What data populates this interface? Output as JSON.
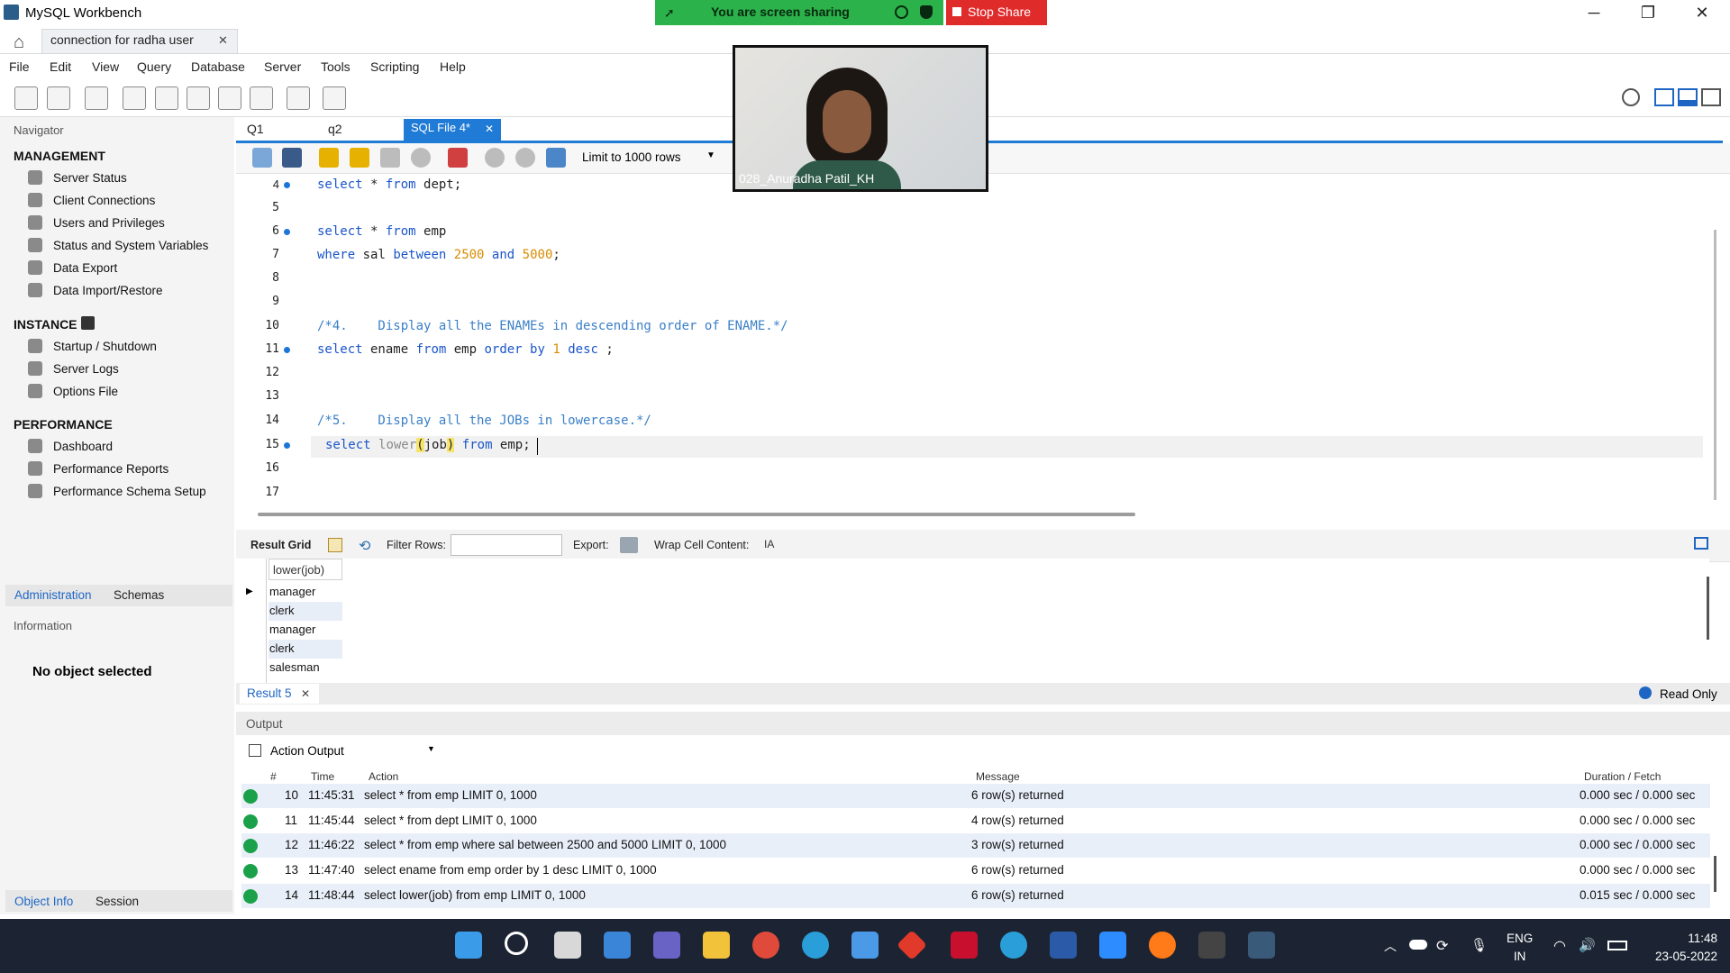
{
  "app": {
    "title": "MySQL Workbench",
    "connection_tab": "connection for radha  user"
  },
  "share": {
    "banner": "You are screen sharing",
    "stop": "Stop Share",
    "participant": "028_Anuradha Patil_KH"
  },
  "menu": [
    "File",
    "Edit",
    "View",
    "Query",
    "Database",
    "Server",
    "Tools",
    "Scripting",
    "Help"
  ],
  "navigator": {
    "header": "Navigator",
    "management": "MANAGEMENT",
    "management_items": [
      "Server Status",
      "Client Connections",
      "Users and Privileges",
      "Status and System Variables",
      "Data Export",
      "Data Import/Restore"
    ],
    "instance": "INSTANCE",
    "instance_items": [
      "Startup / Shutdown",
      "Server Logs",
      "Options File"
    ],
    "performance": "PERFORMANCE",
    "performance_items": [
      "Dashboard",
      "Performance Reports",
      "Performance Schema Setup"
    ],
    "tab_admin": "Administration",
    "tab_schemas": "Schemas",
    "info_header": "Information",
    "no_object": "No object selected",
    "tab_objinfo": "Object Info",
    "tab_session": "Session"
  },
  "editor_tabs": [
    "Q1",
    "q2",
    "SQL File 4*"
  ],
  "limit": "Limit to 1000 rows",
  "code_lines": {
    "l4": "4",
    "l5": "5",
    "l6": "6",
    "l7": "7",
    "l8": "8",
    "l9": "9",
    "l10": "10",
    "l11": "11",
    "l12": "12",
    "l13": "13",
    "l14": "14",
    "l15": "15",
    "l16": "16",
    "l17": "17"
  },
  "code": {
    "c4a": "select",
    "c4b": " * ",
    "c4c": "from",
    "c4d": " dept;",
    "c6a": "select",
    "c6b": " * ",
    "c6c": "from",
    "c6d": " emp",
    "c7a": "where",
    "c7b": " sal ",
    "c7c": "between",
    "c7d": " ",
    "c7e": "2500",
    "c7f": " ",
    "c7g": "and",
    "c7h": " ",
    "c7i": "5000",
    "c7j": ";",
    "c10": "/*4.    Display all the ENAMEs in descending order of ENAME.*/",
    "c11a": "select",
    "c11b": " ename ",
    "c11c": "from",
    "c11d": " emp ",
    "c11e": "order by",
    "c11f": " ",
    "c11g": "1",
    "c11h": " ",
    "c11i": "desc",
    "c11j": " ;",
    "c14": "/*5.    Display all the JOBs in lowercase.*/",
    "c15a": "select",
    "c15b": " ",
    "c15c": "lower",
    "c15d": "(",
    "c15e": "job",
    "c15f": ")",
    "c15g": " ",
    "c15h": "from",
    "c15i": " emp;"
  },
  "result_bar": {
    "result_grid": "Result Grid",
    "filter_rows": "Filter Rows:",
    "export": "Export:",
    "wrap": "Wrap Cell Content:",
    "result_tab": "Result 5",
    "read_only": "Read Only"
  },
  "grid": {
    "header": "lower(job)",
    "rows": [
      "manager",
      "clerk",
      "manager",
      "clerk",
      "salesman"
    ]
  },
  "output": {
    "header": "Output",
    "selector": "Action Output",
    "columns": [
      "#",
      "Time",
      "Action",
      "Message",
      "Duration / Fetch"
    ],
    "rows": [
      {
        "n": "10",
        "time": "11:45:31",
        "action": "select * from emp LIMIT 0, 1000",
        "msg": "6 row(s) returned",
        "dur": "0.000 sec / 0.000 sec"
      },
      {
        "n": "11",
        "time": "11:45:44",
        "action": "select * from dept LIMIT 0, 1000",
        "msg": "4 row(s) returned",
        "dur": "0.000 sec / 0.000 sec"
      },
      {
        "n": "12",
        "time": "11:46:22",
        "action": "select * from emp  where sal between 2500 and 5000 LIMIT 0, 1000",
        "msg": "3 row(s) returned",
        "dur": "0.000 sec / 0.000 sec"
      },
      {
        "n": "13",
        "time": "11:47:40",
        "action": "select ename from emp order by 1 desc LIMIT 0, 1000",
        "msg": "6 row(s) returned",
        "dur": "0.000 sec / 0.000 sec"
      },
      {
        "n": "14",
        "time": "11:48:44",
        "action": "select lower(job) from emp LIMIT 0, 1000",
        "msg": "6 row(s) returned",
        "dur": "0.015 sec / 0.000 sec"
      }
    ]
  },
  "taskbar": {
    "lang1": "ENG",
    "lang2": "IN",
    "time": "11:48",
    "date": "23-05-2022"
  }
}
